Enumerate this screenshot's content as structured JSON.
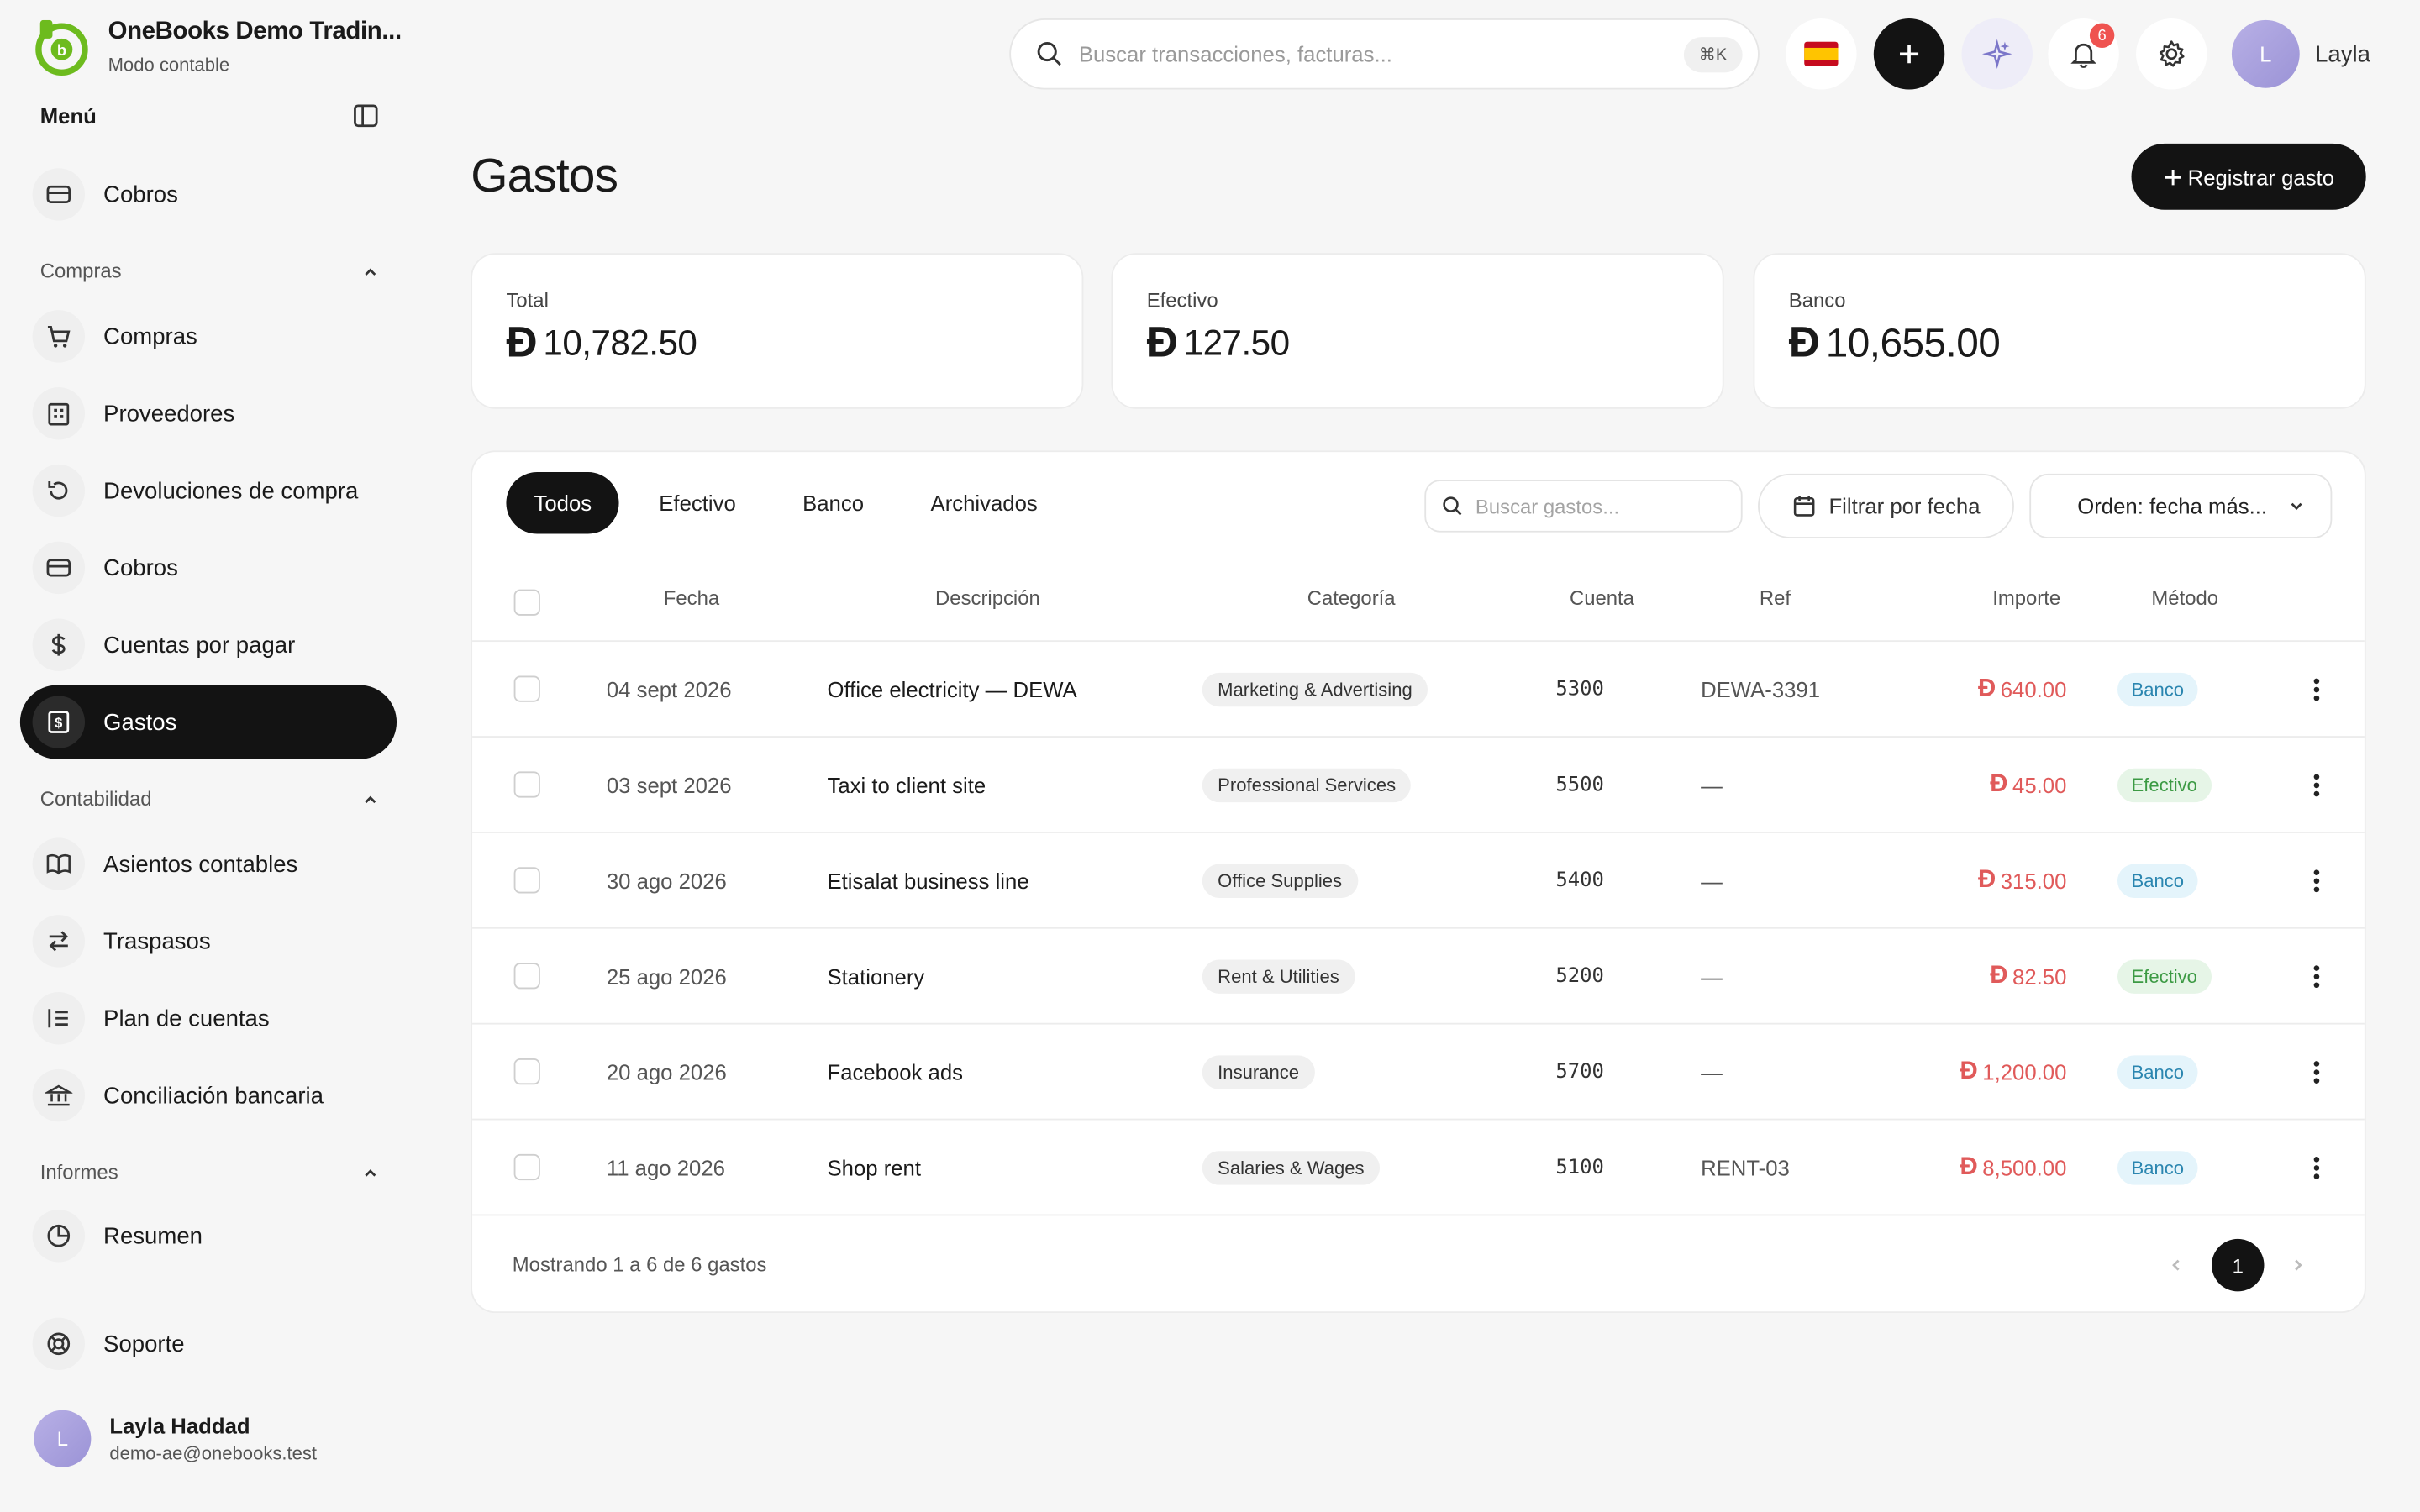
{
  "app": {
    "name": "OneBooks Demo Tradin...",
    "mode": "Modo contable"
  },
  "menu": {
    "title": "Menú"
  },
  "sidebar": {
    "top_item": {
      "label": "Cobros",
      "icon": "card-icon"
    },
    "sections": [
      {
        "title": "Compras",
        "items": [
          {
            "label": "Compras",
            "icon": "cart-icon"
          },
          {
            "label": "Proveedores",
            "icon": "building-icon"
          },
          {
            "label": "Devoluciones de compra",
            "icon": "return-icon"
          },
          {
            "label": "Cobros",
            "icon": "card-icon"
          },
          {
            "label": "Cuentas por pagar",
            "icon": "dollar-icon"
          },
          {
            "label": "Gastos",
            "icon": "receipt-icon",
            "active": true
          }
        ]
      },
      {
        "title": "Contabilidad",
        "items": [
          {
            "label": "Asientos contables",
            "icon": "book-icon"
          },
          {
            "label": "Traspasos",
            "icon": "transfer-icon"
          },
          {
            "label": "Plan de cuentas",
            "icon": "list-icon"
          },
          {
            "label": "Conciliación bancaria",
            "icon": "bank-icon"
          }
        ]
      },
      {
        "title": "Informes",
        "items": [
          {
            "label": "Resumen",
            "icon": "pie-icon"
          }
        ]
      }
    ],
    "support": {
      "label": "Soporte",
      "icon": "lifebuoy-icon"
    },
    "profile": {
      "initial": "L",
      "name": "Layla Haddad",
      "email": "demo-ae@onebooks.test"
    }
  },
  "topbar": {
    "search_placeholder": "Buscar transacciones, facturas...",
    "shortcut": "⌘K",
    "notifications_count": "6",
    "user_initial": "L",
    "user_name": "Layla"
  },
  "page": {
    "title": "Gastos",
    "primary_action": "Registrar gasto"
  },
  "summary": [
    {
      "label": "Total",
      "currency": "Ð",
      "value": "10,782.50"
    },
    {
      "label": "Efectivo",
      "currency": "Ð",
      "value": "127.50"
    },
    {
      "label": "Banco",
      "currency": "Ð",
      "value": "10,655.00"
    }
  ],
  "tabs": [
    "Todos",
    "Efectivo",
    "Banco",
    "Archivados"
  ],
  "filters": {
    "search_placeholder": "Buscar gastos...",
    "date_filter": "Filtrar por fecha",
    "sort": "Orden: fecha más..."
  },
  "table": {
    "columns": [
      "Fecha",
      "Descripción",
      "Categoría",
      "Cuenta",
      "Ref",
      "Importe",
      "Método"
    ],
    "rows": [
      {
        "date": "04 sept 2026",
        "description": "Office electricity — DEWA",
        "category": "Marketing & Advertising",
        "account": "5300",
        "ref": "DEWA-3391",
        "currency": "Ð",
        "amount": "640.00",
        "method": "Banco"
      },
      {
        "date": "03 sept 2026",
        "description": "Taxi to client site",
        "category": "Professional Services",
        "account": "5500",
        "ref": "—",
        "currency": "Ð",
        "amount": "45.00",
        "method": "Efectivo"
      },
      {
        "date": "30 ago 2026",
        "description": "Etisalat business line",
        "category": "Office Supplies",
        "account": "5400",
        "ref": "—",
        "currency": "Ð",
        "amount": "315.00",
        "method": "Banco"
      },
      {
        "date": "25 ago 2026",
        "description": "Stationery",
        "category": "Rent & Utilities",
        "account": "5200",
        "ref": "—",
        "currency": "Ð",
        "amount": "82.50",
        "method": "Efectivo"
      },
      {
        "date": "20 ago 2026",
        "description": "Facebook ads",
        "category": "Insurance",
        "account": "5700",
        "ref": "—",
        "currency": "Ð",
        "amount": "1,200.00",
        "method": "Banco"
      },
      {
        "date": "11 ago 2026",
        "description": "Shop rent",
        "category": "Salaries & Wages",
        "account": "5100",
        "ref": "RENT-03",
        "currency": "Ð",
        "amount": "8,500.00",
        "method": "Banco"
      }
    ]
  },
  "pagination": {
    "summary": "Mostrando 1 a 6 de 6 gastos",
    "current": "1"
  },
  "colors": {
    "brand": "#6dbb1e",
    "dark": "#131313",
    "negative": "#e05a5a",
    "bank_badge": "#e4f4fb",
    "cash_badge": "#e6f5e7"
  }
}
